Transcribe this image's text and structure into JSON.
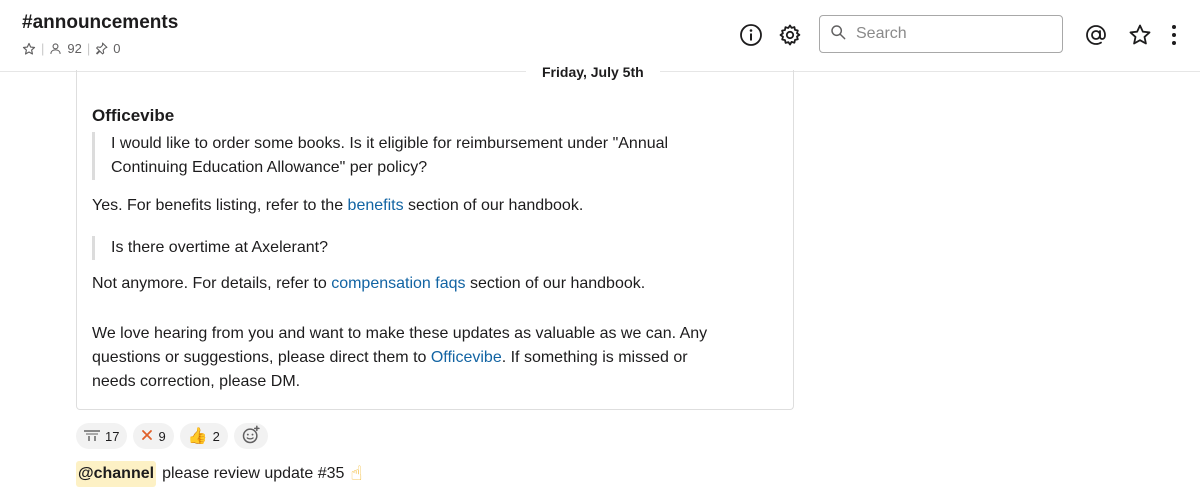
{
  "header": {
    "channel_name": "#announcements",
    "member_count": "92",
    "pinned_count": "0",
    "search_placeholder": "Search"
  },
  "date_divider": "Friday, July 5th",
  "message": {
    "author": "Officevibe",
    "quote1_line1": "I would like to order some books. Is it eligible for reimbursement under \"Annual",
    "quote1_line2": "Continuing Education Allowance\" per policy?",
    "answer1_pre": "Yes. For benefits listing, refer to the ",
    "answer1_link": "benefits",
    "answer1_post": " section of our handbook.",
    "quote2": "Is there overtime at Axelerant?",
    "answer2_pre": "Not anymore. For details, refer to ",
    "answer2_link": "compensation faqs",
    "answer2_post": " section of our handbook.",
    "closing_line1": "We love hearing from you and want to make these updates as valuable as we can. Any",
    "closing_line2_pre": "questions or suggestions, please direct them to ",
    "closing_line2_link": "Officevibe",
    "closing_line2_post": ". If something is missed or",
    "closing_line3": "needs correction, please DM."
  },
  "reactions": [
    {
      "icon": "flag-emoji",
      "count": "17"
    },
    {
      "icon": "tool-emoji",
      "count": "9"
    },
    {
      "icon": "thumbs-up-emoji",
      "count": "2"
    }
  ],
  "footer": {
    "mention": "@channel",
    "text": "please review update #35",
    "icon": "pointing-up-emoji"
  },
  "colors": {
    "link": "#1264a3",
    "mention_bg": "#fdf1c5",
    "reaction_bg": "#f2f2f2"
  }
}
